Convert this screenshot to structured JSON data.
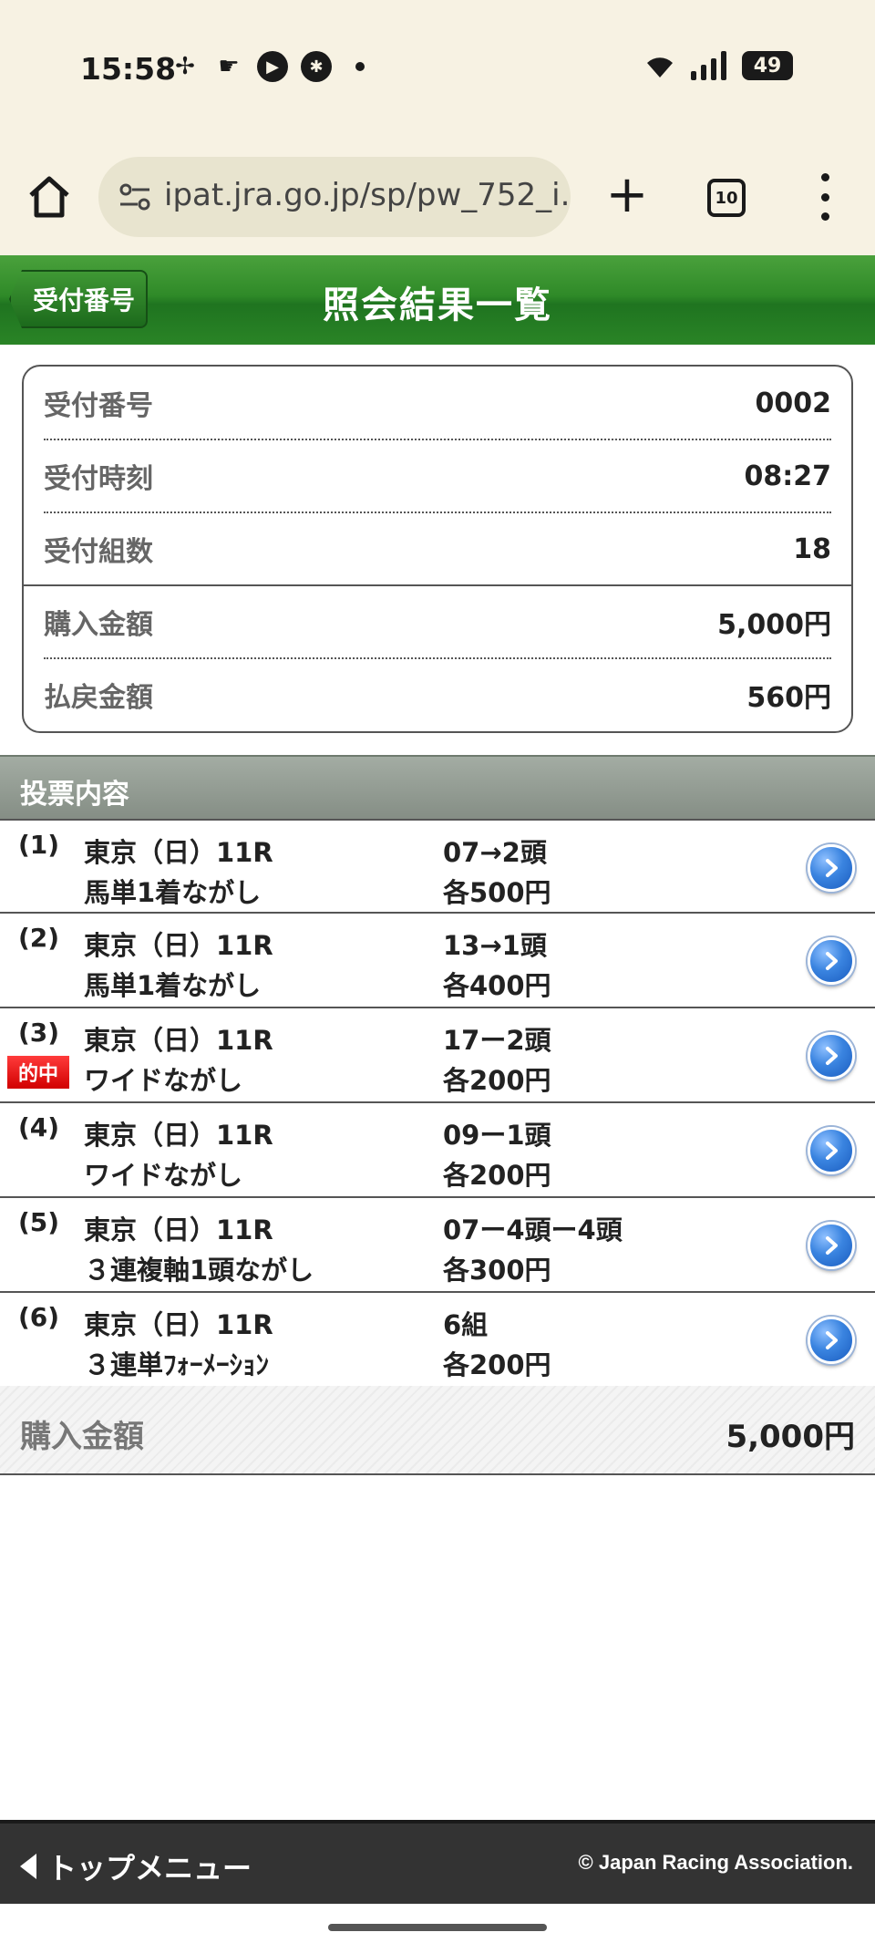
{
  "status_bar": {
    "time": "15:58",
    "left_icons": [
      "pinwheel-icon",
      "hand-icon",
      "play-icon",
      "asterisk-icon",
      "dot-icon"
    ],
    "right_icons": [
      "wifi-icon",
      "signal-icon"
    ],
    "battery": "49"
  },
  "browser": {
    "url": "ipat.jra.go.jp/sp/pw_752_i.c",
    "tab_count": "10"
  },
  "header": {
    "back_label": "受付番号",
    "title": "照会結果一覧"
  },
  "summary": {
    "rows": [
      {
        "label": "受付番号",
        "value": "0002"
      },
      {
        "label": "受付時刻",
        "value": "08:27"
      },
      {
        "label": "受付組数",
        "value": "18"
      },
      {
        "label": "購入金額",
        "value": "5,000円"
      },
      {
        "label": "払戻金額",
        "value": "560円"
      }
    ]
  },
  "bets": {
    "section_title": "投票内容",
    "hit_label": "的中",
    "items": [
      {
        "num": "(1)",
        "race": "東京（日）11R",
        "type": "馬単1着ながし",
        "combo": "07→2頭",
        "amount": "各500円",
        "hit": false
      },
      {
        "num": "(2)",
        "race": "東京（日）11R",
        "type": "馬単1着ながし",
        "combo": "13→1頭",
        "amount": "各400円",
        "hit": false
      },
      {
        "num": "(3)",
        "race": "東京（日）11R",
        "type": "ワイドながし",
        "combo": "17ー2頭",
        "amount": "各200円",
        "hit": true
      },
      {
        "num": "(4)",
        "race": "東京（日）11R",
        "type": "ワイドながし",
        "combo": "09ー1頭",
        "amount": "各200円",
        "hit": false
      },
      {
        "num": "(5)",
        "race": "東京（日）11R",
        "type": "３連複軸1頭ながし",
        "combo": "07ー4頭ー4頭",
        "amount": "各300円",
        "hit": false
      },
      {
        "num": "(6)",
        "race": "東京（日）11R",
        "type": "３連単ﾌｫｰﾒｰｼｮﾝ",
        "combo": "6組",
        "amount": "各200円",
        "hit": false
      }
    ]
  },
  "total": {
    "label": "購入金額",
    "value": "5,000円"
  },
  "footer": {
    "menu_label": "トップメニュー",
    "copyright": "© Japan Racing Association."
  },
  "colors": {
    "header_green": "#2f8a28",
    "section_gray": "#959e95",
    "hit_red": "#e00000",
    "arrow_blue": "#3a84e0"
  }
}
